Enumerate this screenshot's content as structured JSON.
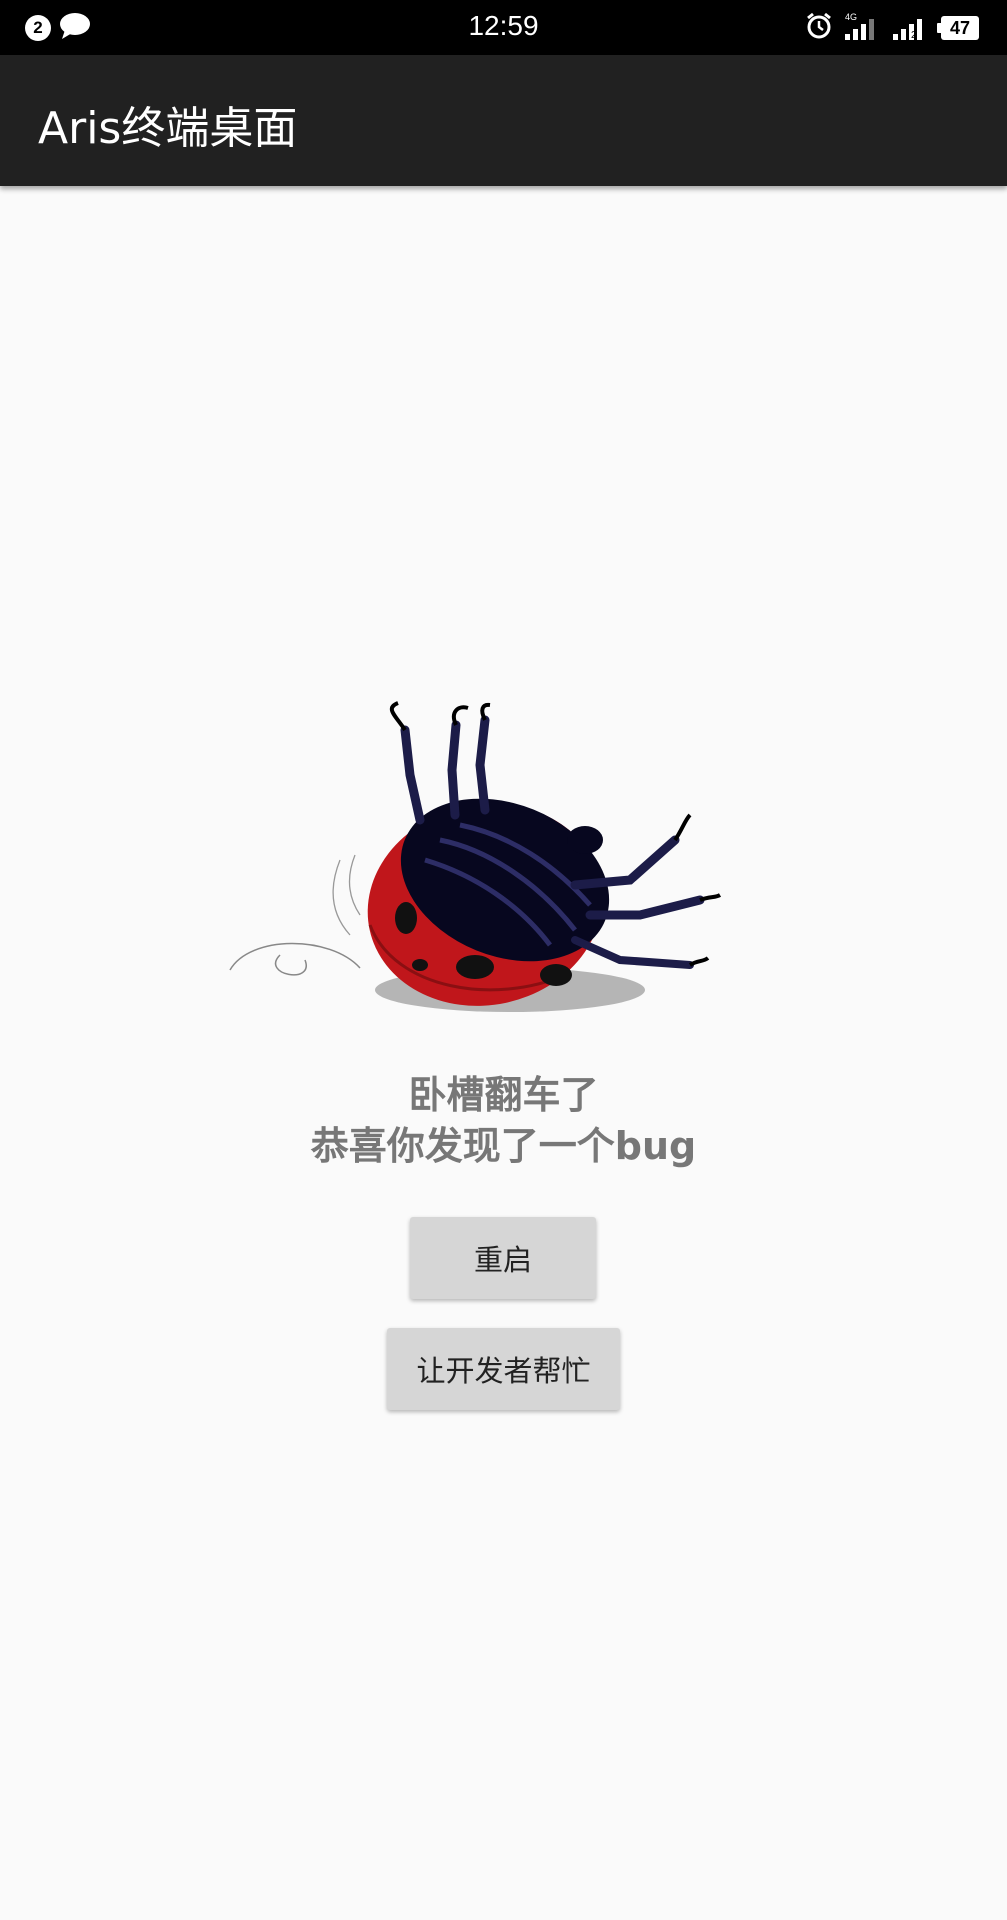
{
  "status_bar": {
    "notification_count": "2",
    "time": "12:59",
    "network_label": "4G",
    "sim_label": "2",
    "battery": "47",
    "icons": [
      "notification-count-icon",
      "message-bubble-icon",
      "alarm-clock-icon",
      "signal-4g-icon",
      "signal-sim2-icon",
      "battery-icon"
    ]
  },
  "app_bar": {
    "title": "Aris终端桌面"
  },
  "error": {
    "line1": "卧槽翻车了",
    "line2": "恭喜你发现了一个bug",
    "illustration": "flipped-ladybug-illustration"
  },
  "actions": {
    "restart_label": "重启",
    "help_label": "让开发者帮忙"
  },
  "colors": {
    "app_bar": "#212121",
    "background": "#fafafa",
    "button": "#d6d6d6",
    "message_text": "#777777",
    "ladybug_red": "#c0161b"
  }
}
